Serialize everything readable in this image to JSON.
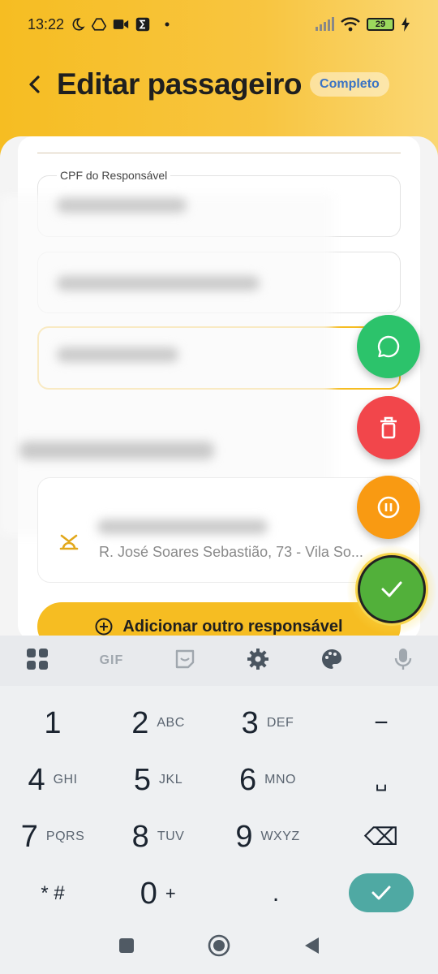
{
  "status_bar": {
    "time": "13:22",
    "battery": "29",
    "icons": [
      "moon-icon",
      "drive-icon",
      "video-icon",
      "sigma-icon",
      "dot-icon",
      "signal-icon",
      "wifi-icon",
      "battery-icon",
      "charging-icon"
    ]
  },
  "header": {
    "title": "Editar passageiro",
    "badge": "Completo",
    "back_icon": "chevron-left-icon"
  },
  "form": {
    "cpf_label": "CPF do Responsável",
    "address": "R. José Soares Sebastião, 73 - Vila So...",
    "add_button": "Adicionar outro responsável"
  },
  "fabs": {
    "whatsapp": "whatsapp-icon",
    "delete": "trash-icon",
    "pause": "pause-icon",
    "save": "check-icon"
  },
  "colors": {
    "header": "#f6bd22",
    "whatsapp": "#2cc36b",
    "delete": "#f2464b",
    "pause": "#f99a12",
    "save": "#52b03a",
    "keyboard_ok": "#4fa9a3"
  },
  "keyboard": {
    "toolbar": [
      "apps-icon",
      "GIF",
      "sticker-icon",
      "settings-icon",
      "palette-icon",
      "mic-icon"
    ],
    "gif_label": "GIF",
    "keys": [
      {
        "num": "1",
        "letters": ""
      },
      {
        "num": "2",
        "letters": "ABC"
      },
      {
        "num": "3",
        "letters": "DEF"
      },
      {
        "num": "−",
        "letters": ""
      },
      {
        "num": "4",
        "letters": "GHI"
      },
      {
        "num": "5",
        "letters": "JKL"
      },
      {
        "num": "6",
        "letters": "MNO"
      },
      {
        "num": "␣",
        "letters": ""
      },
      {
        "num": "7",
        "letters": "PQRS"
      },
      {
        "num": "8",
        "letters": "TUV"
      },
      {
        "num": "9",
        "letters": "WXYZ"
      },
      {
        "num": "⌫",
        "letters": ""
      },
      {
        "num": "* #",
        "letters": ""
      },
      {
        "num": "0",
        "letters": "+"
      },
      {
        "num": ".",
        "letters": ""
      }
    ]
  },
  "nav": [
    "recents-icon",
    "home-icon",
    "back-icon"
  ]
}
